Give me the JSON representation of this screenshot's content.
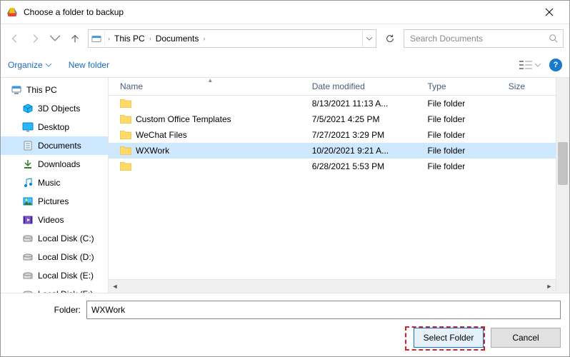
{
  "title": "Choose a folder to backup",
  "breadcrumb": {
    "root": "This PC",
    "folder": "Documents"
  },
  "search": {
    "placeholder": "Search Documents"
  },
  "toolbar": {
    "organize": "Organize",
    "newfolder": "New folder"
  },
  "tree": [
    {
      "label": "This PC",
      "icon": "pc",
      "child": false,
      "selected": false
    },
    {
      "label": "3D Objects",
      "icon": "3d",
      "child": true,
      "selected": false
    },
    {
      "label": "Desktop",
      "icon": "desktop",
      "child": true,
      "selected": false
    },
    {
      "label": "Documents",
      "icon": "docs",
      "child": true,
      "selected": true
    },
    {
      "label": "Downloads",
      "icon": "downloads",
      "child": true,
      "selected": false
    },
    {
      "label": "Music",
      "icon": "music",
      "child": true,
      "selected": false
    },
    {
      "label": "Pictures",
      "icon": "pictures",
      "child": true,
      "selected": false
    },
    {
      "label": "Videos",
      "icon": "videos",
      "child": true,
      "selected": false
    },
    {
      "label": "Local Disk (C:)",
      "icon": "disk",
      "child": true,
      "selected": false
    },
    {
      "label": "Local Disk (D:)",
      "icon": "disk",
      "child": true,
      "selected": false
    },
    {
      "label": "Local Disk (E:)",
      "icon": "disk",
      "child": true,
      "selected": false
    },
    {
      "label": "Local Disk (F:)",
      "icon": "disk",
      "child": true,
      "selected": false
    }
  ],
  "columns": {
    "name": "Name",
    "date": "Date modified",
    "type": "Type",
    "size": "Size"
  },
  "rows": [
    {
      "name": "",
      "date": "8/13/2021 11:13 A...",
      "type": "File folder",
      "selected": false
    },
    {
      "name": "Custom Office Templates",
      "date": "7/5/2021 4:25 PM",
      "type": "File folder",
      "selected": false
    },
    {
      "name": "WeChat Files",
      "date": "7/27/2021 3:29 PM",
      "type": "File folder",
      "selected": false
    },
    {
      "name": "WXWork",
      "date": "10/20/2021 9:21 A...",
      "type": "File folder",
      "selected": true
    },
    {
      "name": "",
      "date": "6/28/2021 5:53 PM",
      "type": "File folder",
      "selected": false
    }
  ],
  "bottom": {
    "folder_label": "Folder:",
    "folder_value": "WXWork",
    "select_btn": "Select Folder",
    "cancel_btn": "Cancel"
  }
}
